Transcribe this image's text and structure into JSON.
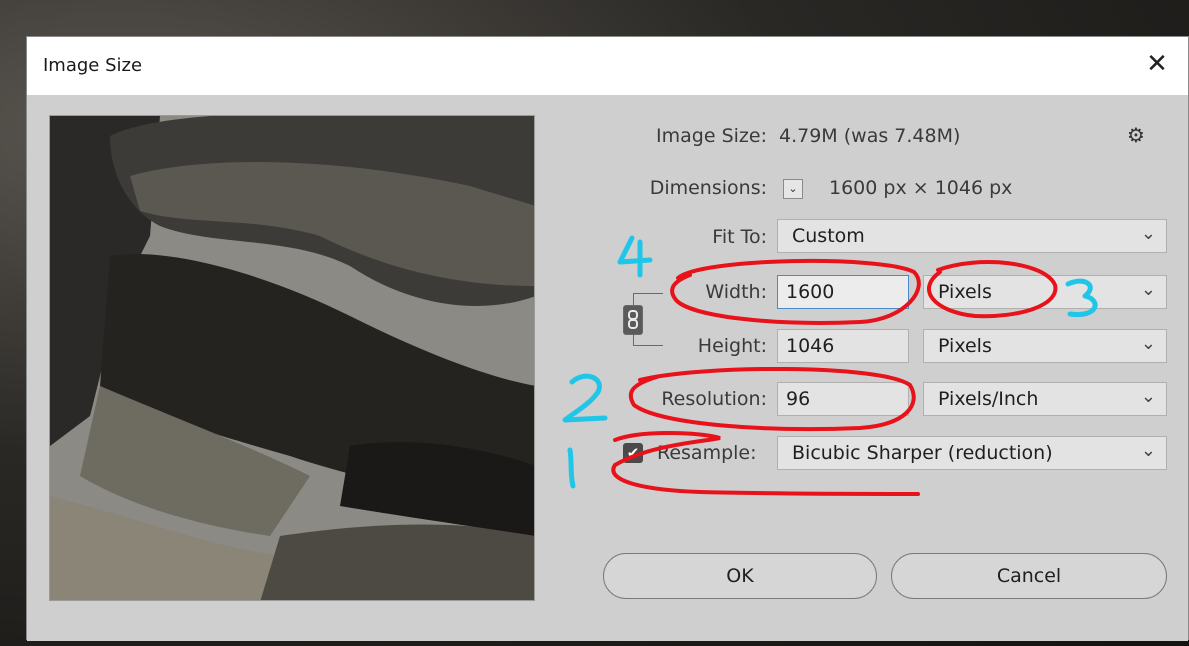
{
  "dialog": {
    "title": "Image Size",
    "close_glyph": "✕"
  },
  "info": {
    "image_size_label": "Image Size:",
    "image_size_value": "4.79M (was 7.48M)",
    "dimensions_label": "Dimensions:",
    "dimensions_value": "1600 px  ×  1046 px",
    "gear_icon": "gear-icon"
  },
  "fit_to": {
    "label": "Fit To:",
    "value": "Custom"
  },
  "width": {
    "label": "Width:",
    "value": "1600",
    "unit": "Pixels"
  },
  "height": {
    "label": "Height:",
    "value": "1046",
    "unit": "Pixels"
  },
  "resolution": {
    "label": "Resolution:",
    "value": "96",
    "unit": "Pixels/Inch"
  },
  "resample": {
    "label": "Resample:",
    "value": "Bicubic Sharper (reduction)",
    "checked": true
  },
  "buttons": {
    "ok": "OK",
    "cancel": "Cancel"
  },
  "annotations": {
    "n1": "1",
    "n2": "2",
    "n3": "3",
    "n4": "4"
  },
  "colors": {
    "annotation_red": "#e8121a",
    "annotation_cyan": "#1fc6e8",
    "focus_blue": "#4a88c8"
  }
}
